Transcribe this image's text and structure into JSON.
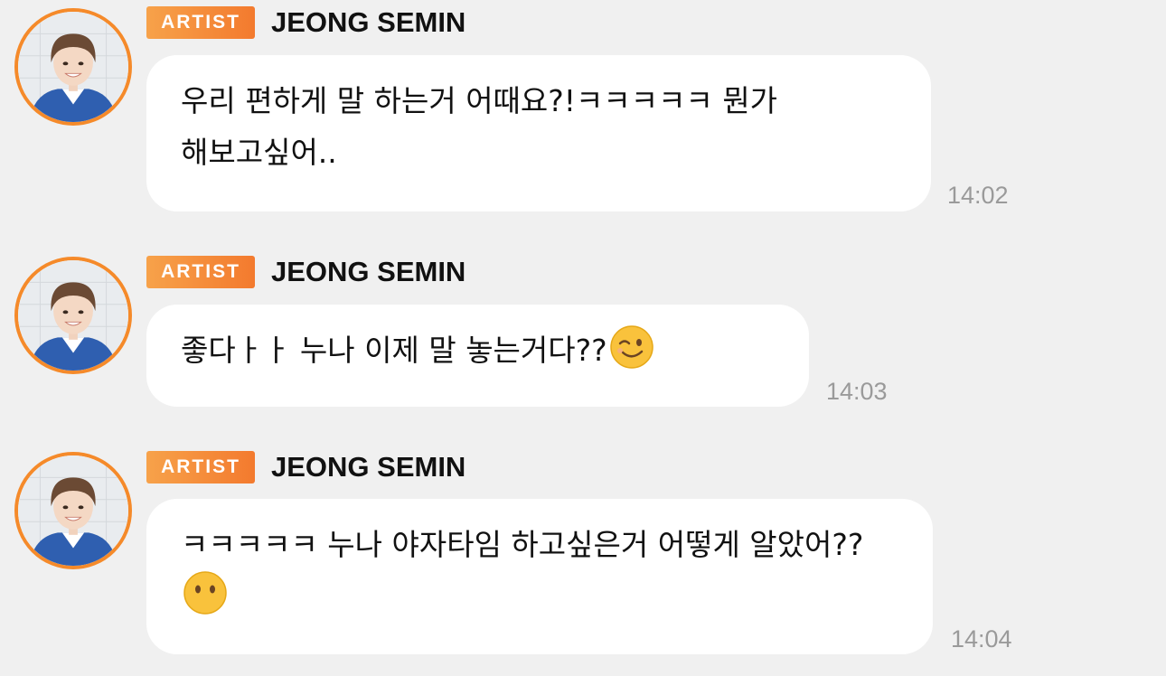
{
  "colors": {
    "background": "#f0f0f0",
    "bubble": "#ffffff",
    "accent": "#f58a2a",
    "timestamp": "#9a9a9a"
  },
  "messages": [
    {
      "badge": "ARTIST",
      "sender": "JEONG SEMIN",
      "avatar_icon": "artist-avatar",
      "text": "우리 편하게 말 하는거 어때요?!ㅋㅋㅋㅋㅋ 뭔가 해보고싶어..",
      "emoji": "",
      "time": "14:02"
    },
    {
      "badge": "ARTIST",
      "sender": "JEONG SEMIN",
      "avatar_icon": "artist-avatar",
      "text": "좋다ㅏㅏ 누나 이제 말 놓는거다??",
      "emoji": "winking-face",
      "time": "14:03"
    },
    {
      "badge": "ARTIST",
      "sender": "JEONG SEMIN",
      "avatar_icon": "artist-avatar",
      "text": "ㅋㅋㅋㅋㅋ 누나 야자타임 하고싶은거 어떻게 알았어??",
      "emoji": "face-without-mouth",
      "time": "14:04"
    }
  ]
}
